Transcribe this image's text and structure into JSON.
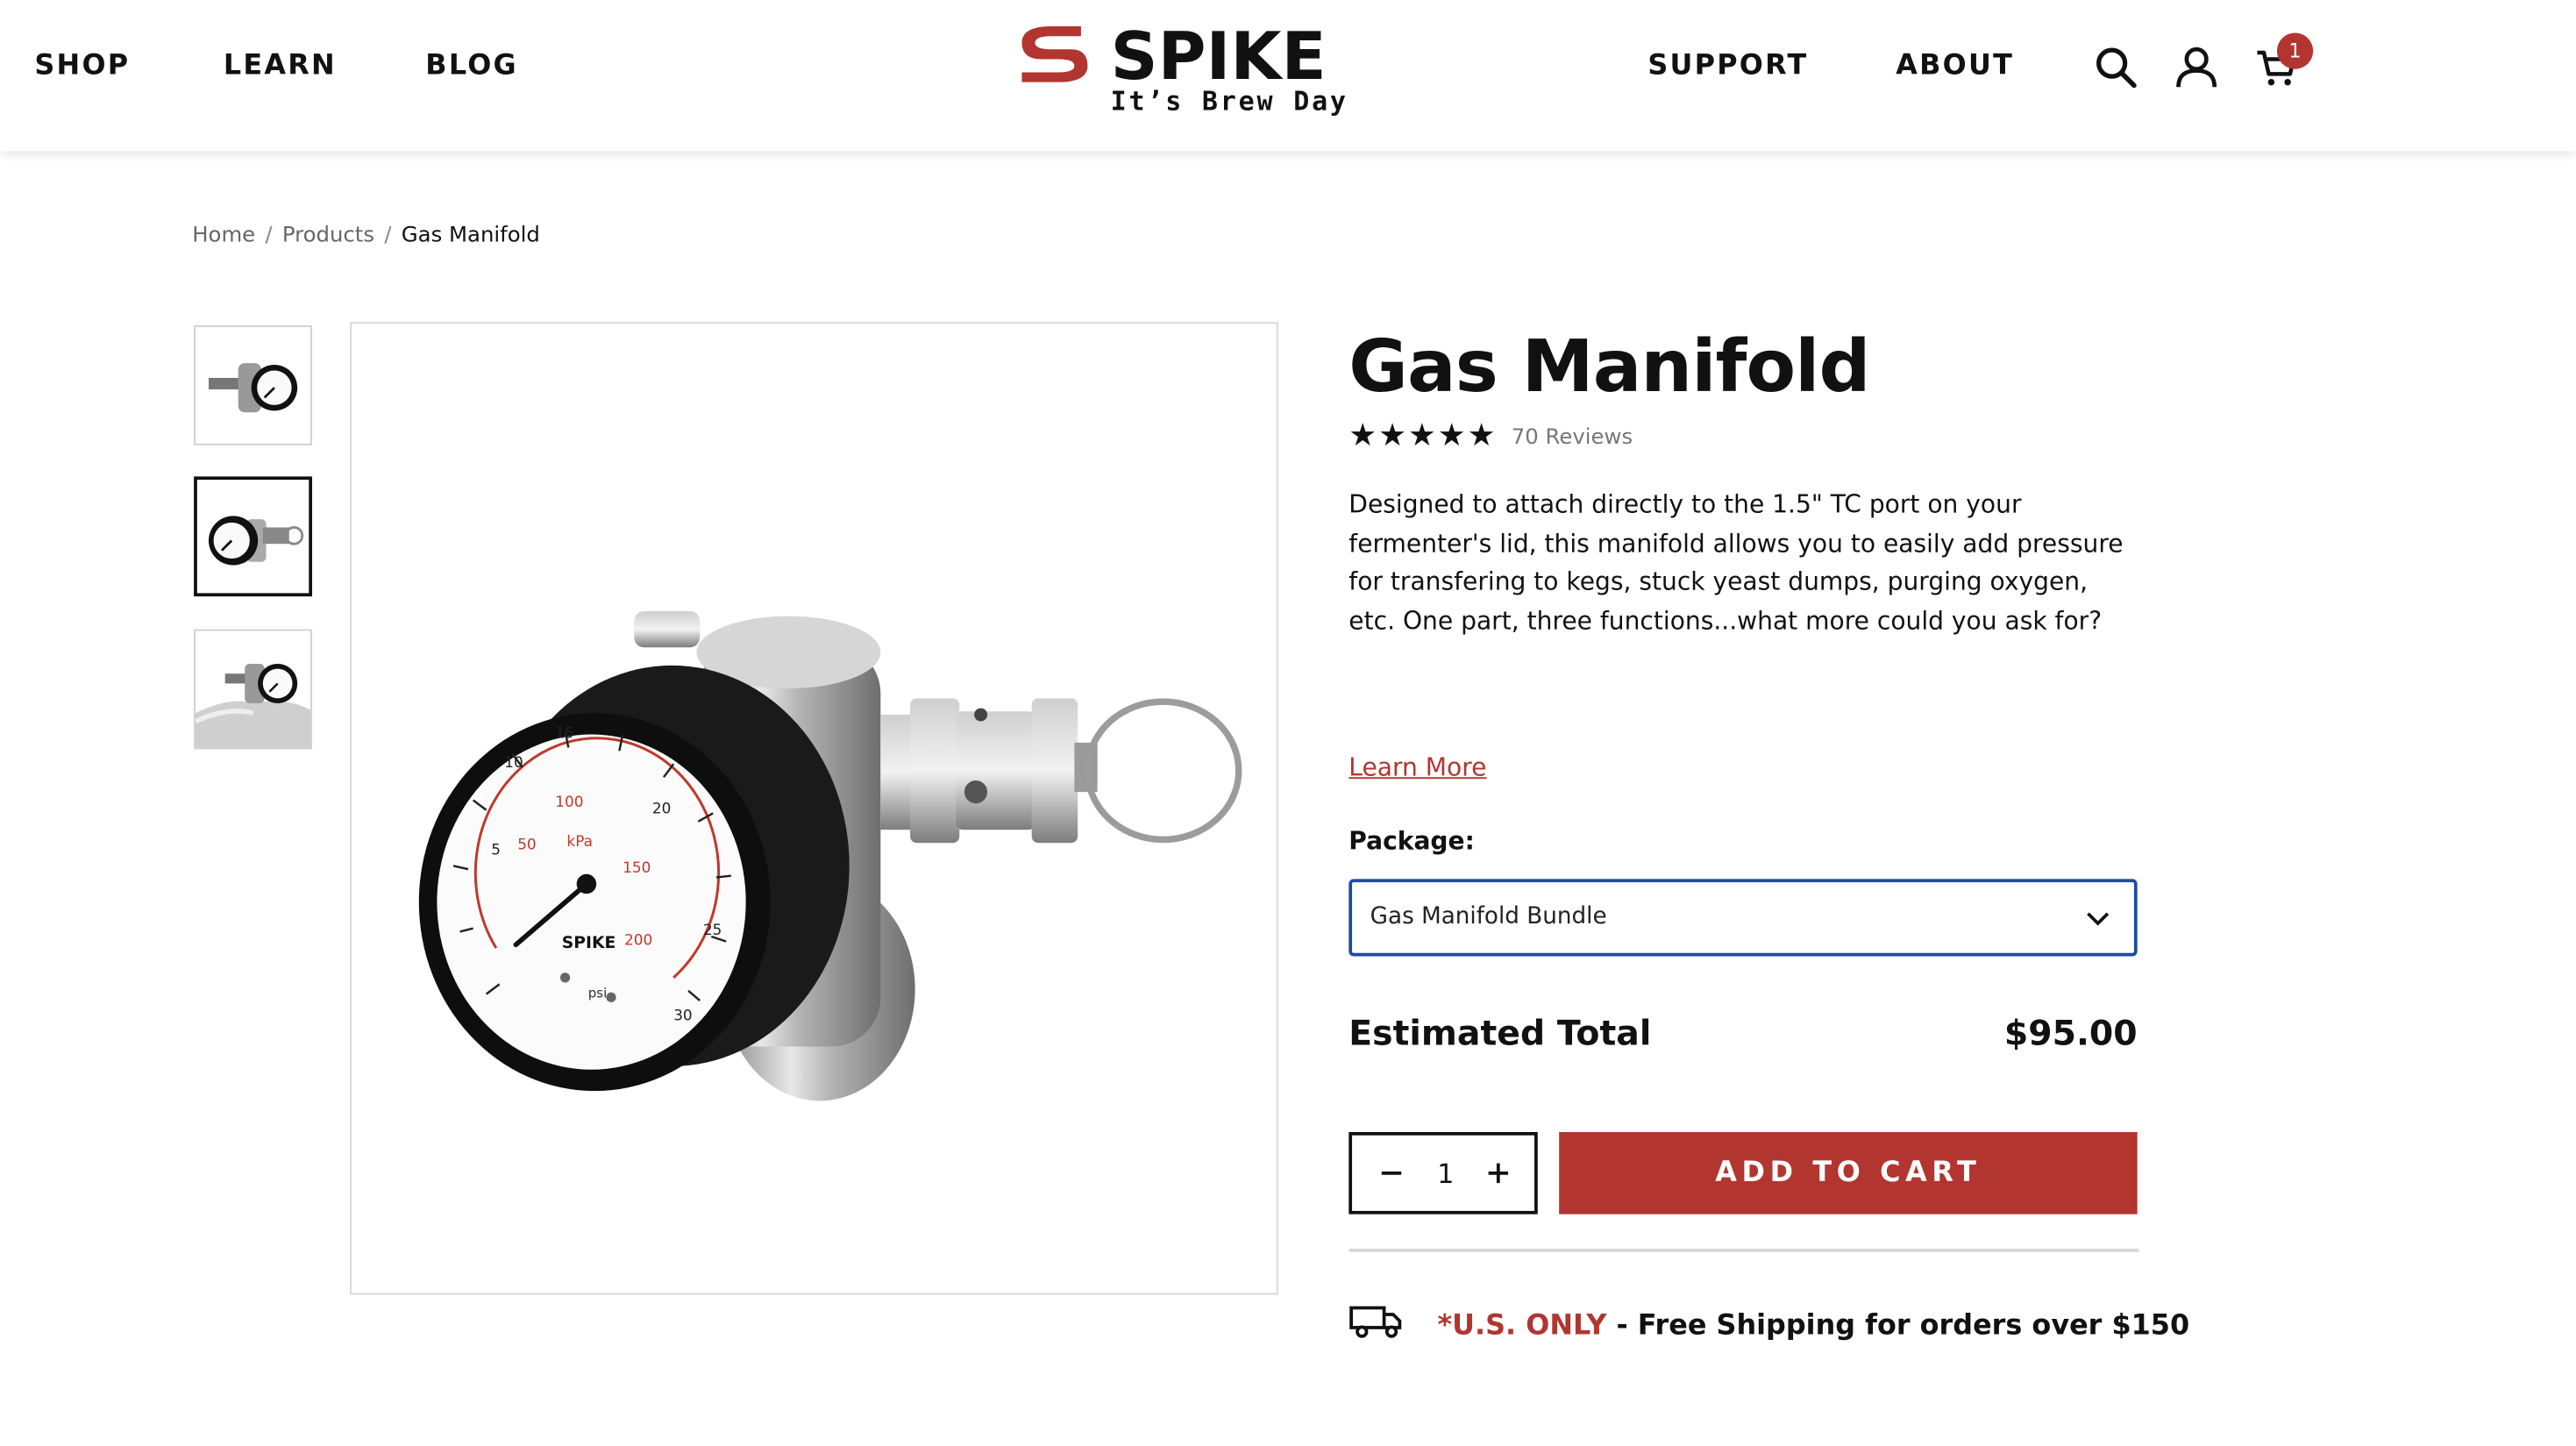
{
  "header": {
    "nav_left": [
      "SHOP",
      "LEARN",
      "BLOG"
    ],
    "nav_right": [
      "SUPPORT",
      "ABOUT"
    ],
    "logo": {
      "word": "SPIKE",
      "tagline": "It’s Brew Day"
    },
    "cart_count": "1"
  },
  "breadcrumb": {
    "home": "Home",
    "products": "Products",
    "current": "Gas Manifold"
  },
  "product": {
    "title": "Gas Manifold",
    "rating": 5,
    "reviews_label": "70 Reviews",
    "description": "Designed to attach directly to the 1.5\" TC port on your fermenter's lid, this manifold allows you to easily add pressure for transfering to kegs, stuck yeast dumps, purging oxygen, etc. One part, three functions...what more could you ask for?",
    "learn_more": "Learn More",
    "package_label": "Package:",
    "package_selected": "Gas Manifold Bundle",
    "estimated_total_label": "Estimated Total",
    "estimated_total_value": "$95.00",
    "quantity": "1",
    "add_to_cart": "ADD TO CART",
    "shipping_highlight": "*U.S. ONLY",
    "shipping_text": " - Free Shipping for orders over $150",
    "gauge_brand": "SPIKE",
    "gauge_units_inner": "kPa",
    "gauge_units_outer": "psi"
  },
  "colors": {
    "accent": "#b23530",
    "select_border": "#1f4aa0",
    "text": "#111111"
  }
}
